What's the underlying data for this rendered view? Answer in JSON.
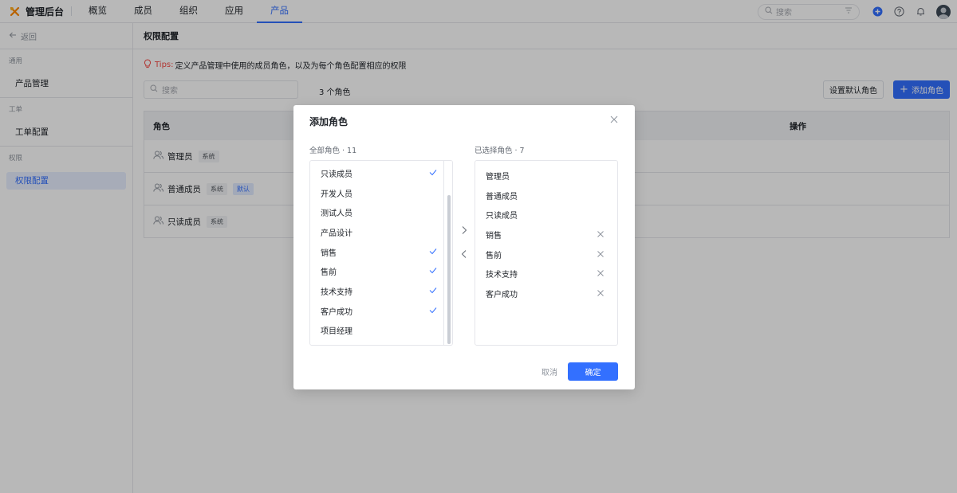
{
  "colors": {
    "accent": "#3370ff",
    "danger": "#f54a45",
    "border": "#e5e6eb",
    "logo_orange": "#ff8800"
  },
  "topbar": {
    "logo_icon": "tools-icon",
    "title": "管理后台",
    "nav": [
      "概览",
      "成员",
      "组织",
      "应用",
      "产品"
    ],
    "active_nav": "产品",
    "search_placeholder": "搜索",
    "icons": [
      "search-icon",
      "filter-icon",
      "plus-circle-icon",
      "help-icon",
      "bell-icon",
      "avatar"
    ]
  },
  "sidebar": {
    "back_label": "返回",
    "groups": [
      {
        "title": "通用",
        "items": [
          {
            "label": "产品管理"
          }
        ]
      },
      {
        "title": "工单",
        "items": [
          {
            "label": "工单配置"
          }
        ]
      },
      {
        "title": "权限",
        "items": [
          {
            "label": "权限配置",
            "active": true
          }
        ]
      }
    ]
  },
  "main": {
    "title": "权限配置",
    "tips_label": "Tips:",
    "tips_text": "定义产品管理中使用的成员角色，以及为每个角色配置相应的权限",
    "search_placeholder": "搜索",
    "role_count": "3 个角色",
    "set_default_button": "设置默认角色",
    "add_role_button": "添加角色",
    "table": {
      "columns": [
        "角色",
        "操作"
      ],
      "rows": [
        {
          "name": "管理员",
          "tags": [
            "系统"
          ]
        },
        {
          "name": "普通成员",
          "tags": [
            "系统",
            "默认"
          ]
        },
        {
          "name": "只读成员",
          "tags": [
            "系统"
          ]
        }
      ]
    }
  },
  "modal": {
    "title": "添加角色",
    "all_roles_title": "全部角色 · 11",
    "selected_title": "已选择角色 · 7",
    "all_roles": [
      {
        "label": "只读成员",
        "checked": true
      },
      {
        "label": "开发人员",
        "checked": false
      },
      {
        "label": "测试人员",
        "checked": false
      },
      {
        "label": "产品设计",
        "checked": false
      },
      {
        "label": "销售",
        "checked": true
      },
      {
        "label": "售前",
        "checked": true
      },
      {
        "label": "技术支持",
        "checked": true
      },
      {
        "label": "客户成功",
        "checked": true
      },
      {
        "label": "项目经理",
        "checked": false
      }
    ],
    "selected_roles": [
      {
        "label": "管理员",
        "removable": false
      },
      {
        "label": "普通成员",
        "removable": false
      },
      {
        "label": "只读成员",
        "removable": false
      },
      {
        "label": "销售",
        "removable": true
      },
      {
        "label": "售前",
        "removable": true
      },
      {
        "label": "技术支持",
        "removable": true
      },
      {
        "label": "客户成功",
        "removable": true
      }
    ],
    "cancel_label": "取消",
    "confirm_label": "确定"
  }
}
